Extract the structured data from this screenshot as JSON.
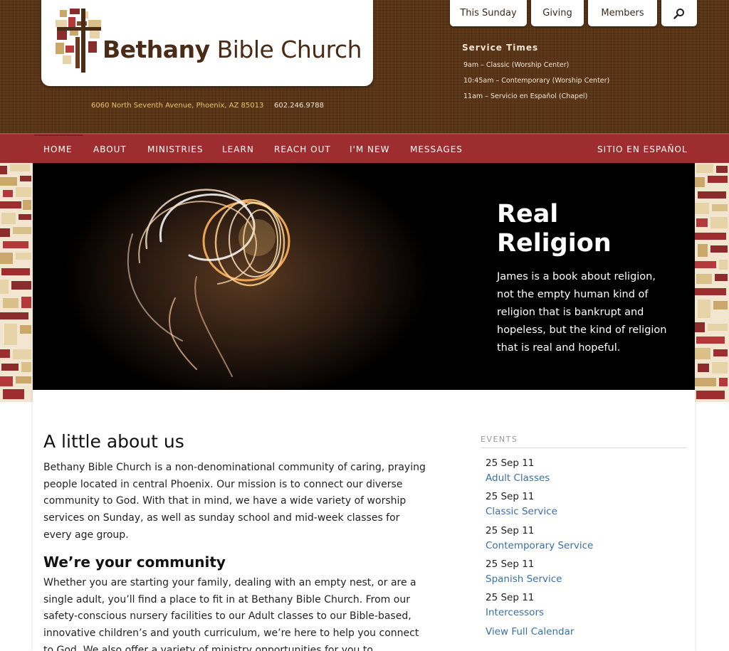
{
  "header": {
    "logo_text_bold": "Bethany",
    "logo_text_rest": " Bible Church",
    "address": "6060 North Seventh Avenue, Phoenix, AZ 85013",
    "phone": "602.246.9788",
    "top_tabs": [
      "This Sunday",
      "Giving",
      "Members"
    ],
    "service_times": {
      "title": "Service Times",
      "lines": [
        "9am – Classic (Worship Center)",
        "10:45am – Contemporary (Worship Center)",
        "11am – Servicio en Español (Chapel)"
      ]
    }
  },
  "nav": {
    "items": [
      "HOME",
      "ABOUT",
      "MINISTRIES",
      "LEARN",
      "REACH OUT",
      "I'M NEW",
      "MESSAGES"
    ],
    "spanish": "SITIO EN ESPAÑOL"
  },
  "hero": {
    "title_line1": "Real",
    "title_line2": "Religion",
    "text_lines": [
      "James is a book about religion,",
      "not the empty human kind of",
      "religion that is bankrupt and",
      "hopeless, but the kind of religion",
      "that is real and hopeful."
    ]
  },
  "main": {
    "heading": "A little about us",
    "para1": [
      "Bethany Bible Church is a non-denominational community of caring, praying",
      "people located in central Phoenix. Our mission is to connect our diverse",
      "community to God. With that in mind, we have a wide variety of worship",
      "services on Sunday, as well as sunday school and mid-week classes for",
      "every age group."
    ],
    "subheading": "We’re your community",
    "para2": [
      "Whether you are starting your family, dealing with an empty nest, or are a",
      "single adult, you’ll find a place to fit in at Bethany Bible Church. From our",
      "safety-conscious nursery facilities to our Adult classes to our Bible-based,",
      "innovative children’s and youth curriculum, we’re here to help you connect",
      "to God. We also offer a variety of ministry opportunities for you to"
    ]
  },
  "events": {
    "label": "EVENTS",
    "items": [
      {
        "date": "25 Sep 11",
        "title": "Adult Classes"
      },
      {
        "date": "25 Sep 11",
        "title": "Classic Service"
      },
      {
        "date": "25 Sep 11",
        "title": "Contemporary Service"
      },
      {
        "date": "25 Sep 11",
        "title": "Spanish Service"
      },
      {
        "date": "25 Sep 11",
        "title": "Intercessors"
      }
    ],
    "calendar_link": "View Full Calendar"
  },
  "colors": {
    "header_brown": "#5a3416",
    "nav_red": "#9e2d2f",
    "link_blue": "#3a6fa6",
    "address_gold": "#e9c36e"
  },
  "icons": {
    "search": "search-icon",
    "logo": "cross-mosaic-logo-icon"
  }
}
